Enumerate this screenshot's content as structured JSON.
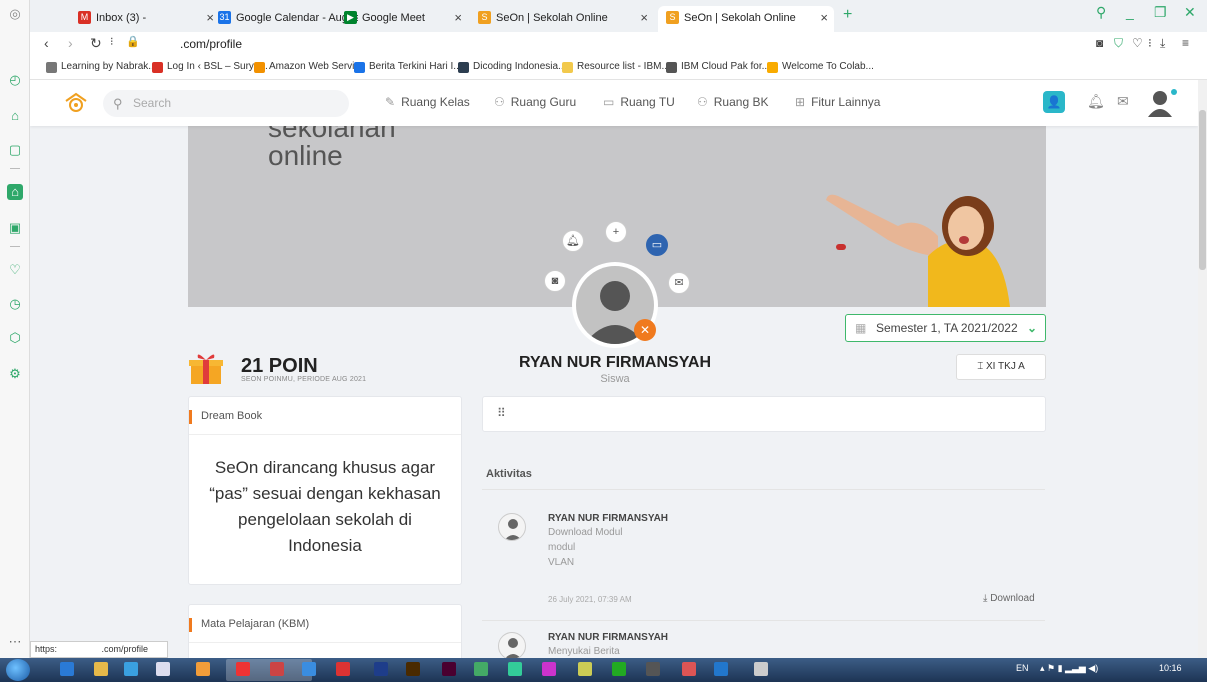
{
  "browser": {
    "tabs": [
      {
        "label": "Inbox (3) -",
        "fav_color": "#d93025",
        "fav_glyph": "M"
      },
      {
        "label": "Google Calendar - August",
        "fav_color": "#1a73e8",
        "fav_glyph": "31"
      },
      {
        "label": "Google Meet",
        "fav_color": "#00832d",
        "fav_glyph": "▶"
      },
      {
        "label": "SeOn | Sekolah Online",
        "fav_color": "#f0a020",
        "fav_glyph": "S"
      },
      {
        "label": "SeOn | Sekolah Online",
        "fav_color": "#f0a020",
        "fav_glyph": "S"
      }
    ],
    "url": ".com/profile",
    "bookmarks": [
      {
        "label": "Learning by Nabrak...",
        "color": "#777"
      },
      {
        "label": "Log In ‹ BSL – Surya...",
        "color": "#d93025"
      },
      {
        "label": "Amazon Web Servi...",
        "color": "#f29100"
      },
      {
        "label": "Berita Terkini Hari I...",
        "color": "#1a73e8"
      },
      {
        "label": "Dicoding Indonesia...",
        "color": "#2d3e50"
      },
      {
        "label": "Resource list - IBM...",
        "color": "#f2c94c"
      },
      {
        "label": "IBM Cloud Pak for...",
        "color": "#555"
      },
      {
        "label": "Welcome To Colab...",
        "color": "#f9ab00"
      }
    ],
    "status_url_a": "https:",
    "status_url_b": ".com/profile"
  },
  "nav": {
    "search_placeholder": "Search",
    "links": [
      {
        "label": "Ruang Kelas",
        "icon": "pencil-icon",
        "glyph": "✎"
      },
      {
        "label": "Ruang Guru",
        "icon": "teacher-icon",
        "glyph": "⚇"
      },
      {
        "label": "Ruang TU",
        "icon": "folder-icon",
        "glyph": "▭"
      },
      {
        "label": "Ruang BK",
        "icon": "people-icon",
        "glyph": "⚇"
      },
      {
        "label": "Fitur Lainnya",
        "icon": "grid-icon",
        "glyph": "⊞"
      }
    ]
  },
  "banner": {
    "brand_line1": "sekolahan",
    "brand_line2": "online"
  },
  "semester": {
    "label": "Semester 1, TA 2021/2022"
  },
  "points": {
    "value": "21 POIN",
    "caption": "SEON POINMU, PERIODE AUG 2021"
  },
  "profile": {
    "name": "RYAN NUR FIRMANSYAH",
    "role": "Siswa",
    "class_label": "XI TKJ A"
  },
  "dream_book": {
    "title": "Dream Book",
    "text": "SeOn dirancang khusus agar “pas” sesuai dengan kekhasan pengelolaan sekolah di Indonesia"
  },
  "mapel": {
    "title": "Mata Pelajaran  (KBM)"
  },
  "feed": {
    "title": "Aktivitas",
    "items": [
      {
        "name": "RYAN NUR FIRMANSYAH",
        "action": "Download Modul",
        "detail1": "modul",
        "detail2": "VLAN",
        "time": "26 July 2021, 07:39 AM",
        "download_label": "Download"
      },
      {
        "name": "RYAN NUR FIRMANSYAH",
        "action": "Menyukai Berita"
      }
    ]
  },
  "taskbar": {
    "lang": "EN",
    "clock": "10:16"
  },
  "colors": {
    "accent_green": "#3fb86b",
    "accent_orange": "#f07a1e",
    "accent_teal": "#2ab7c9",
    "accent_blue": "#2e64b0"
  }
}
